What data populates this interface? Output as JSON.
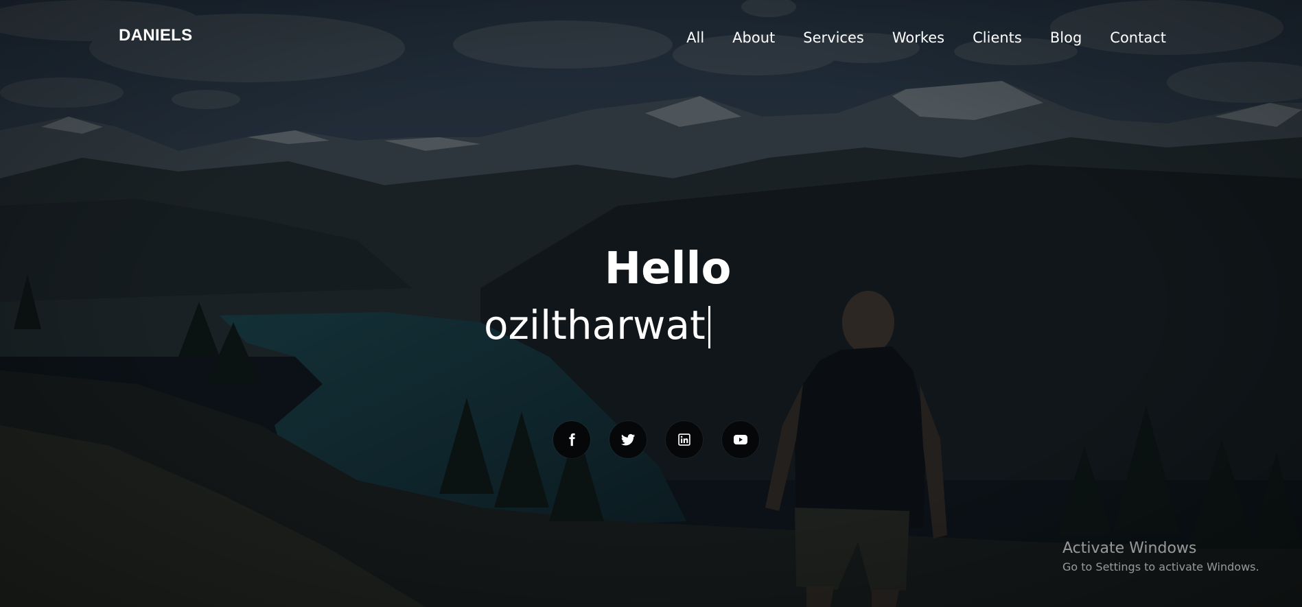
{
  "header": {
    "brand": "DANIELS",
    "nav": [
      {
        "label": "All"
      },
      {
        "label": "About"
      },
      {
        "label": "Services"
      },
      {
        "label": "Workes"
      },
      {
        "label": "Clients"
      },
      {
        "label": "Blog"
      },
      {
        "label": "Contact"
      }
    ]
  },
  "hero": {
    "greeting": "Hello",
    "typed_name": "oziltharwat"
  },
  "social": [
    {
      "icon": "facebook-icon"
    },
    {
      "icon": "twitter-icon"
    },
    {
      "icon": "linkedin-icon"
    },
    {
      "icon": "youtube-icon"
    }
  ],
  "watermark": {
    "title": "Activate Windows",
    "subtitle": "Go to Settings to activate Windows."
  },
  "colors": {
    "text": "#ffffff",
    "overlay": "#0b1216",
    "social_bg": "#050709"
  }
}
